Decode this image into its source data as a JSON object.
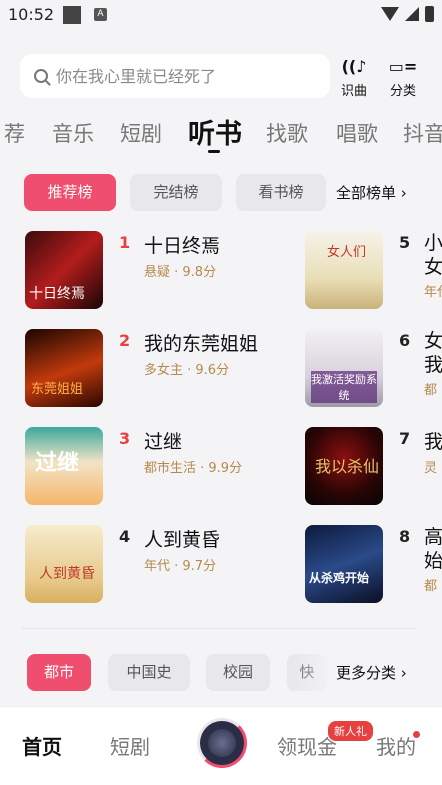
{
  "status_bar": {
    "time": "10:52",
    "icon_a": "A"
  },
  "search": {
    "placeholder": "你在我心里就已经死了"
  },
  "top_actions": [
    {
      "label": "识曲",
      "icon": "music-recognition-icon",
      "glyph": "((♪"
    },
    {
      "label": "分类",
      "icon": "category-icon",
      "glyph": "▭="
    }
  ],
  "category_tabs": [
    "荐",
    "音乐",
    "短剧",
    "听书",
    "找歌",
    "唱歌",
    "抖音"
  ],
  "active_category": "听书",
  "rank_chips": [
    "推荐榜",
    "完结榜",
    "看书榜"
  ],
  "all_rank_label": "全部榜单 ›",
  "books": [
    {
      "rank": "1",
      "title": "十日终焉",
      "meta": "悬疑 · 9.8分",
      "cover_text": "十日终焉"
    },
    {
      "rank": "2",
      "title": "我的东莞姐姐",
      "meta": "多女主 · 9.6分",
      "cover_text": "东莞姐姐"
    },
    {
      "rank": "3",
      "title": "过继",
      "meta": "都市生活 · 9.9分",
      "cover_text": "过继"
    },
    {
      "rank": "4",
      "title": "人到黄昏",
      "meta": "年代 · 9.7分",
      "cover_text": "人到黄昏"
    },
    {
      "rank": "5",
      "title": "小女",
      "meta": "年代",
      "cover_text": "女人们"
    },
    {
      "rank": "6",
      "title": "女我",
      "meta": "都",
      "cover_text": "我激活奖励系统"
    },
    {
      "rank": "7",
      "title": "我",
      "meta": "灵",
      "cover_text": "我以杀仙"
    },
    {
      "rank": "8",
      "title": "高始",
      "meta": "都",
      "cover_text": "从杀鸡开始"
    }
  ],
  "genre_chips": [
    "都市",
    "中国史",
    "校园",
    "快"
  ],
  "more_genre_label": "更多分类 ›",
  "bottom_nav": {
    "home": "首页",
    "drama": "短剧",
    "earn": "领现金",
    "mine": "我的",
    "badge": "新人礼"
  },
  "colors": {
    "accent": "#f04e6e",
    "rank_red": "#e64040",
    "meta_gold": "#b58a4d"
  }
}
